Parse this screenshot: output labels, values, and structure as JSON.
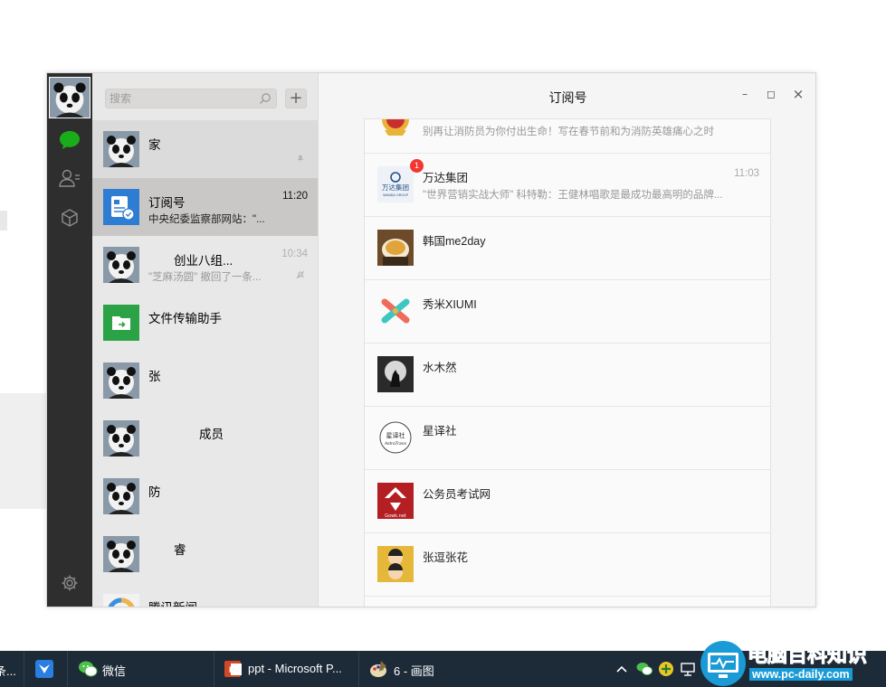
{
  "window": {
    "title": "订阅号",
    "controls": {
      "minimize": "–",
      "maximize": "◻",
      "close": "×"
    }
  },
  "nav": {
    "items": [
      {
        "name": "chat",
        "icon": "chat-bubble-icon",
        "active": true
      },
      {
        "name": "contacts",
        "icon": "contacts-icon"
      },
      {
        "name": "favorites",
        "icon": "cube-icon"
      }
    ],
    "settings_icon": "gear-icon",
    "active_color": "#1aad19"
  },
  "sidebar": {
    "search_placeholder": "搜索",
    "add_label": "+",
    "conversations": [
      {
        "name": "家",
        "preview": "",
        "time": "",
        "flag": "pin-icon",
        "avatar": "panda"
      },
      {
        "name": "订阅号",
        "preview": "中央纪委监察部网站：\"...",
        "time": "11:20",
        "avatar": "subscription"
      },
      {
        "name": "创业八组...",
        "preview": "\"芝麻汤圆\" 撤回了一条...",
        "time": "10:34",
        "flag": "mute-icon",
        "avatar": "panda"
      },
      {
        "name": "文件传输助手",
        "preview": "",
        "time": "",
        "avatar": "file"
      },
      {
        "name": "张",
        "preview": "",
        "time": "",
        "avatar": "panda"
      },
      {
        "name": "成员",
        "preview": "",
        "time": "",
        "avatar": "panda"
      },
      {
        "name": "防",
        "preview": "",
        "time": "",
        "avatar": "panda"
      },
      {
        "name": "睿",
        "preview": "",
        "time": "",
        "avatar": "panda"
      },
      {
        "name": "腾讯新闻",
        "preview": "",
        "time": "",
        "avatar": "news"
      }
    ]
  },
  "subscriptions": [
    {
      "name": "",
      "desc": "别再让消防员为你付出生命！写在春节前和为消防英雄痛心之时",
      "time": "",
      "avatar": "emblem"
    },
    {
      "name": "万达集团",
      "desc": "\"世界营销实战大师\" 科特勒：王健林唱歌是最成功最高明的品牌...",
      "time": "11:03",
      "badge": "1",
      "avatar": "wanda",
      "avatar_text": "万达集团",
      "avatar_sub": "WANDA GROUP"
    },
    {
      "name": "韩国me2day",
      "desc": "",
      "time": "",
      "avatar": "food"
    },
    {
      "name": "秀米XIUMI",
      "desc": "",
      "time": "",
      "avatar": "xiumi"
    },
    {
      "name": "水木然",
      "desc": "",
      "time": "",
      "avatar": "wolf"
    },
    {
      "name": "星译社",
      "desc": "",
      "time": "",
      "avatar": "astro",
      "avatar_text": "星译社",
      "avatar_sub": "AstroTrans"
    },
    {
      "name": "公务员考试网",
      "desc": "",
      "time": "",
      "avatar": "gwy",
      "avatar_text": "Gowk.net"
    },
    {
      "name": "张逗张花",
      "desc": "",
      "time": "",
      "avatar": "faces"
    }
  ],
  "taskbar": {
    "items": [
      {
        "label": "条...",
        "icon": ""
      },
      {
        "label": "",
        "icon": "mail-bird-icon"
      },
      {
        "label": "微信",
        "icon": "wechat-icon"
      },
      {
        "label": "ppt - Microsoft P...",
        "icon": "powerpoint-icon"
      },
      {
        "label": "6 - 画图",
        "icon": "paint-icon"
      }
    ],
    "tray_icons": [
      "chevron-up-icon",
      "wechat-tray-icon",
      "plus-circle-icon",
      "network-icon"
    ]
  },
  "watermark": {
    "title": "电脑百科知识",
    "url": "www.pc-daily.com"
  },
  "colors": {
    "nav_bg": "#2e2e2e",
    "list_bg": "#e9e8e8",
    "active_row": "#c9c8c7",
    "badge": "#f43530",
    "taskbar": "#1d2b38",
    "watermark_blue": "#1a9ad6"
  }
}
